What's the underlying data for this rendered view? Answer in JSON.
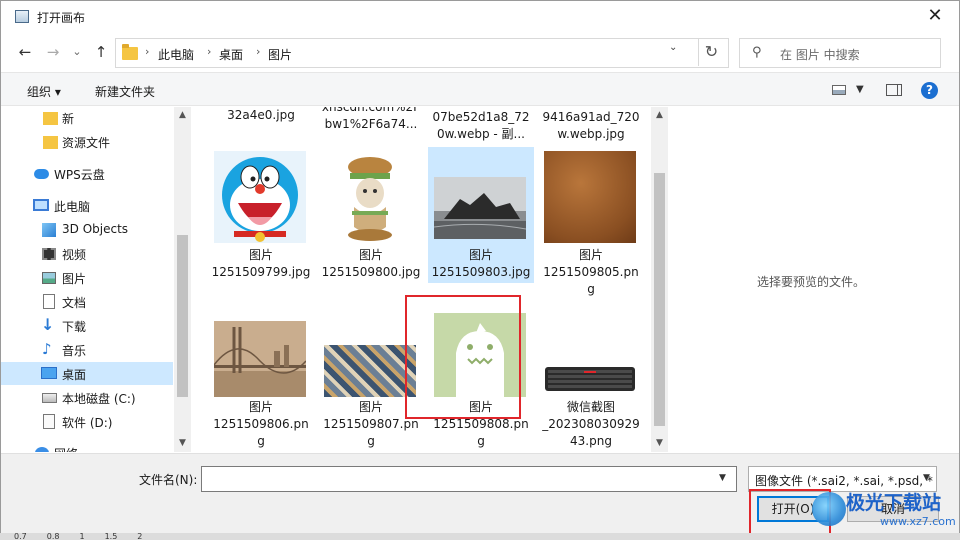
{
  "window": {
    "title": "打开画布"
  },
  "nav": {
    "back": "←",
    "forward": "→",
    "recent": "⌄",
    "up": "↑",
    "breadcrumbs": [
      "此电脑",
      "桌面",
      "图片"
    ],
    "separator": "›",
    "refresh": "↻",
    "search_placeholder": "在 图片 中搜索"
  },
  "toolbar": {
    "organize": "组织 ▾",
    "new_folder": "新建文件夹",
    "help": "?"
  },
  "sidebar": {
    "items": [
      {
        "label": "新",
        "icon": "folder-icon"
      },
      {
        "label": "资源文件",
        "icon": "folder-icon"
      },
      {
        "label": "WPS云盘",
        "icon": "cloud-icon"
      },
      {
        "label": "此电脑",
        "icon": "computer-icon"
      },
      {
        "label": "3D Objects",
        "icon": "cube-icon"
      },
      {
        "label": "视频",
        "icon": "video-icon"
      },
      {
        "label": "图片",
        "icon": "pictures-icon"
      },
      {
        "label": "文档",
        "icon": "document-icon"
      },
      {
        "label": "下载",
        "icon": "download-icon"
      },
      {
        "label": "音乐",
        "icon": "music-icon"
      },
      {
        "label": "桌面",
        "icon": "desktop-icon",
        "selected": true
      },
      {
        "label": "本地磁盘 (C:)",
        "icon": "drive-icon"
      },
      {
        "label": "软件 (D:)",
        "icon": "drive-icon"
      },
      {
        "label": "网络",
        "icon": "network-icon"
      }
    ]
  },
  "files": {
    "top_row_partial": [
      "32a4e0.jpg",
      "xhscdn.com%2F\nbw1%2F6a74...",
      "07be52d1a8_72\n0w.webp - 副...",
      "9416a91ad_720\nw.webp.jpg"
    ],
    "items": [
      {
        "caption": "图片\n1251509799.jpg",
        "thumb": "doraemon"
      },
      {
        "caption": "图片\n1251509800.jpg",
        "thumb": "burger-cat"
      },
      {
        "caption": "图片\n1251509803.jpg",
        "thumb": "sea-rock",
        "selected": true
      },
      {
        "caption": "图片\n1251509805.pn\ng",
        "thumb": "leather"
      },
      {
        "caption": "图片\n1251509806.pn\ng",
        "thumb": "bridge"
      },
      {
        "caption": "图片\n1251509807.pn\ng",
        "thumb": "city"
      },
      {
        "caption": "图片\n1251509808.pn\ng",
        "thumb": "green-monster"
      },
      {
        "caption": "微信截图\n_202308030929\n43.png",
        "thumb": "keyboard"
      }
    ]
  },
  "preview": {
    "text": "选择要预览的文件。"
  },
  "bottom": {
    "filename_label": "文件名(N):",
    "filename_value": "",
    "filetype": "图像文件 (*.sai2, *.sai, *.psd, *",
    "open_button": "打开(O)",
    "cancel_button": "取消"
  },
  "watermark": {
    "brand": "极光下载站",
    "url": "www.xz7.com"
  },
  "underlying_ruler": [
    "0.7",
    "0.8",
    "1",
    "1.5",
    "2"
  ]
}
